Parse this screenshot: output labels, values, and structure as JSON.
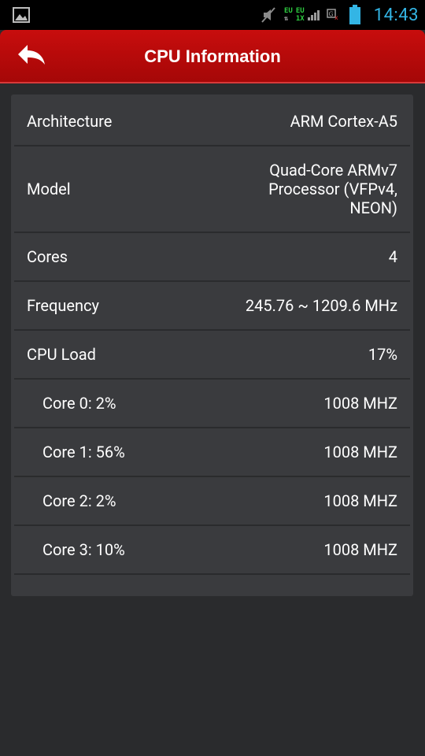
{
  "status_bar": {
    "time": "14:43",
    "network_top": "EU",
    "network_arrows": "⇅",
    "network2_top": "EU",
    "network2_bottom": "1X",
    "icons": [
      "gallery-icon",
      "mute-icon",
      "signal-icon",
      "gx-icon",
      "battery-icon"
    ]
  },
  "action_bar": {
    "title": "CPU Information",
    "back_icon": "back-arrow-icon",
    "color": "#b90a0a"
  },
  "info": {
    "rows": [
      {
        "label": "Architecture",
        "value": "ARM Cortex-A5"
      },
      {
        "label": "Model",
        "value_lines": [
          "Quad-Core ARMv7",
          "Processor (VFPv4,",
          "NEON)"
        ]
      },
      {
        "label": "Cores",
        "value": "4"
      },
      {
        "label": "Frequency",
        "value": "245.76 ~ 1209.6 MHz"
      },
      {
        "label": "CPU Load",
        "value": "17%"
      },
      {
        "label": "Core 0: 2%",
        "value": "1008 MHZ"
      },
      {
        "label": "Core 1: 56%",
        "value": "1008 MHZ"
      },
      {
        "label": "Core 2: 2%",
        "value": "1008 MHZ"
      },
      {
        "label": "Core 3: 10%",
        "value": "1008 MHZ"
      }
    ]
  },
  "colors": {
    "background": "#2a2b2d",
    "panel": "#3a3b3e",
    "accent_time": "#33b5e5",
    "network": "#2ecc40"
  }
}
